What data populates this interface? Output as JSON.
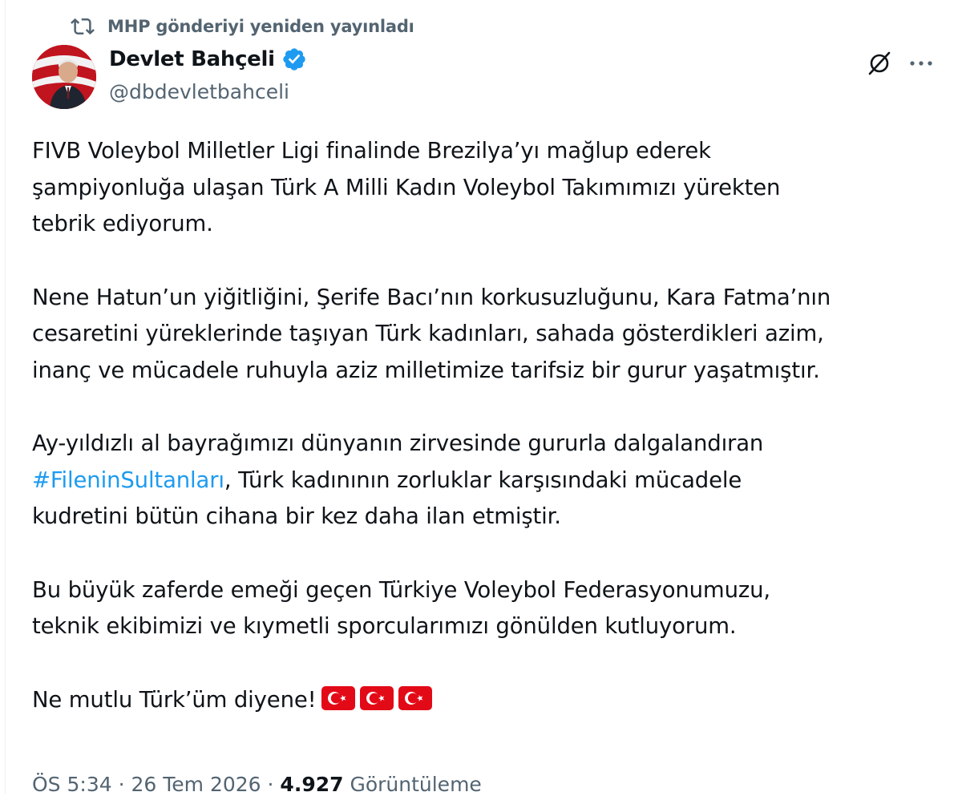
{
  "repost": {
    "text": "MHP gönderiyi yeniden yayınladı"
  },
  "author": {
    "name": "Devlet Bahçeli",
    "handle": "@dbdevletbahceli"
  },
  "icons": {
    "repost": "repost-icon",
    "verified": "verified-badge-icon",
    "grok": "grok-icon",
    "more": "more-options-icon",
    "flag": "turkey-flag-emoji"
  },
  "colors": {
    "text": "#0f1419",
    "muted": "#536471",
    "accent": "#1d9bf0",
    "flag_red": "#e30a17"
  },
  "tweet": {
    "p1": [
      "FIVB Voleybol Milletler Ligi finalinde Brezilya’yı mağlup ederek",
      "şampiyonluğa ulaşan Türk A Milli Kadın Voleybol Takımımızı yürekten",
      "tebrik ediyorum."
    ],
    "p2": [
      "Nene Hatun’un yiğitliğini, Şerife Bacı’nın korkusuzluğunu, Kara Fatma’nın",
      "cesaretini yüreklerinde taşıyan Türk kadınları, sahada gösterdikleri azim,",
      "inanç ve mücadele ruhuyla aziz milletimize tarifsiz bir gurur yaşatmıştır."
    ],
    "p3": {
      "line1": "Ay-yıldızlı al bayrağımızı dünyanın zirvesinde gururla dalgalandıran",
      "hashtag": "#FileninSultanları",
      "line2_rest": ", Türk kadınının zorluklar karşısındaki mücadele",
      "line3": "kudretini bütün cihana bir kez daha ilan etmiştir."
    },
    "p4": [
      "Bu büyük zaferde emeği geçen Türkiye Voleybol Federasyonumuzu,",
      "teknik ekibimizi ve kıymetli sporcularımızı gönülden kutluyorum."
    ],
    "p5": "Ne mutlu Türk’üm diyene!",
    "flag_count": 3
  },
  "meta": {
    "time": "ÖS 5:34",
    "sep": " · ",
    "date": "26 Tem 2026",
    "views": "4.927",
    "views_label": "Görüntüleme"
  }
}
